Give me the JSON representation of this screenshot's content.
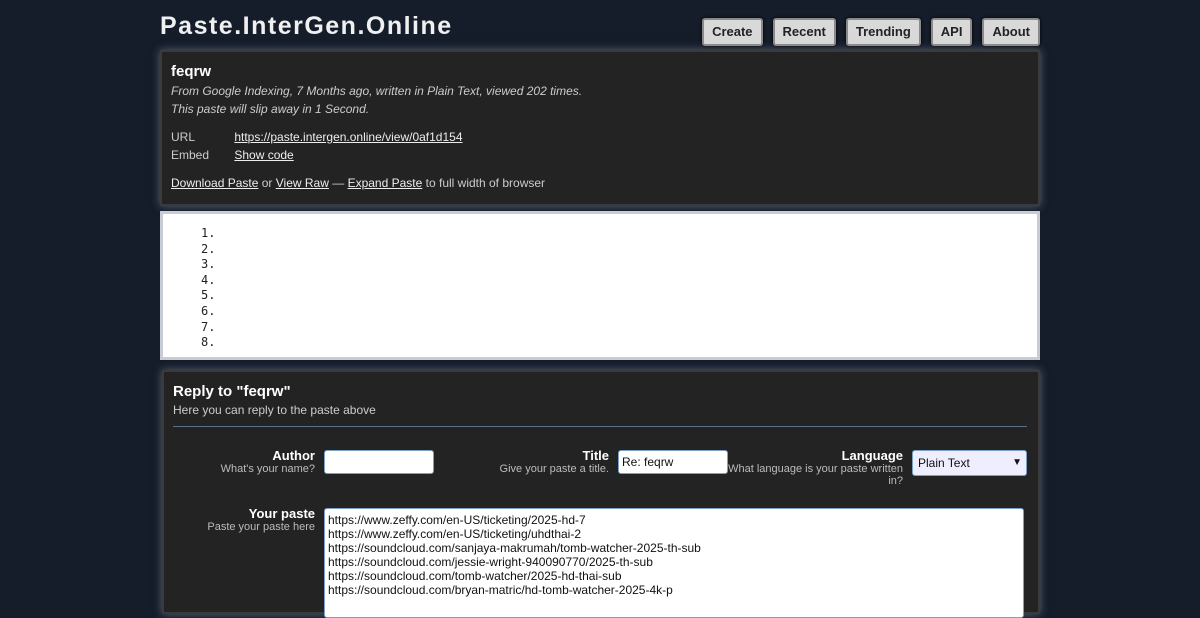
{
  "site": {
    "title": "Paste.InterGen.Online"
  },
  "nav": {
    "items": [
      "Create",
      "Recent",
      "Trending",
      "API",
      "About"
    ]
  },
  "paste": {
    "name": "feqrw",
    "meta_line1": "From Google Indexing, 7 Months ago, written in Plain Text, viewed 202 times.",
    "meta_line2": "This paste will slip away in 1 Second.",
    "url_label": "URL",
    "url": "https://paste.intergen.online/view/0af1d154",
    "embed_label": "Embed",
    "embed_link": "Show code",
    "download_link": "Download Paste",
    "or_text": "or",
    "view_raw_link": "View Raw",
    "dash_text": "—",
    "expand_link": "Expand Paste",
    "expand_suffix": "to full width of browser"
  },
  "code": {
    "lines": [
      "1.",
      "2.",
      "3.",
      "4.",
      "5.",
      "6.",
      "7.",
      "8."
    ]
  },
  "reply": {
    "title": "Reply to \"feqrw\"",
    "subtitle": "Here you can reply to the paste above",
    "author_label": "Author",
    "author_hint": "What's your name?",
    "author_value": "",
    "title_label": "Title",
    "title_hint": "Give your paste a title.",
    "title_value": "Re: feqrw",
    "language_label": "Language",
    "language_hint": "What language is your paste written in?",
    "language_value": "Plain Text",
    "paste_label": "Your paste",
    "paste_hint": "Paste your paste here",
    "paste_lines": [
      "https://www.zeffy.com/en-US/ticketing/2025-hd-7",
      "https://www.zeffy.com/en-US/ticketing/uhdthai-2",
      "https://soundcloud.com/sanjaya-makrumah/tomb-watcher-2025-th-sub",
      "https://soundcloud.com/jessie-wright-940090770/2025-th-sub",
      "https://soundcloud.com/tomb-watcher/2025-hd-thai-sub",
      "https://soundcloud.com/bryan-matric/hd-tomb-watcher-2025-4k-p"
    ]
  }
}
